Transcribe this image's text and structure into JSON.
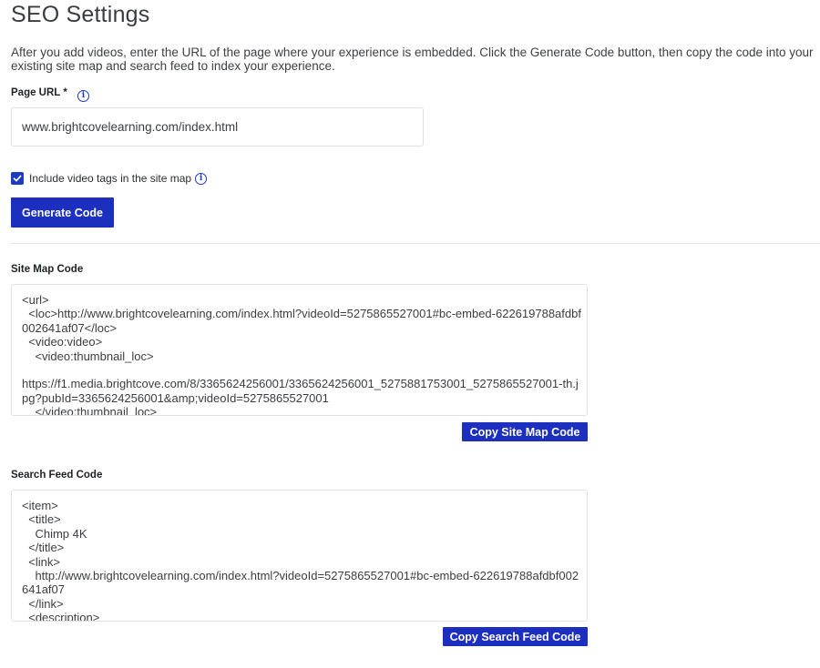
{
  "page": {
    "title": "SEO Settings",
    "intro": "After you add videos, enter the URL of the page where your experience is embedded. Click the Generate Code button, then copy the code into your existing site map and search feed to index your experience."
  },
  "page_url": {
    "label": "Page URL",
    "required_marker": "*",
    "value": "www.brightcovelearning.com/index.html"
  },
  "video_tags": {
    "label": "Include video tags in the site map",
    "checked": true
  },
  "generate_button": {
    "label": "Generate Code"
  },
  "site_map": {
    "label": "Site Map Code",
    "code": "<url>\n  <loc>http://www.brightcovelearning.com/index.html?videoId=5275865527001#bc-embed-622619788afdbf002641af07</loc>\n  <video:video>\n    <video:thumbnail_loc>\n\nhttps://f1.media.brightcove.com/8/3365624256001/3365624256001_5275881753001_5275865527001-th.jpg?pubId=3365624256001&amp;videoId=5275865527001\n    </video:thumbnail_loc>",
    "copy_label": "Copy Site Map Code"
  },
  "search_feed": {
    "label": "Search Feed Code",
    "code": "<item>\n  <title>\n    Chimp 4K\n  </title>\n  <link>\n    http://www.brightcovelearning.com/index.html?videoId=5275865527001#bc-embed-622619788afdbf002641af07\n  </link>\n  <description>",
    "copy_label": "Copy Search Feed Code"
  },
  "icons": {
    "info": "info-icon",
    "checkbox": "checkmark-icon"
  },
  "colors": {
    "accent": "#1d2fbf",
    "border": "#dfe2e5"
  }
}
